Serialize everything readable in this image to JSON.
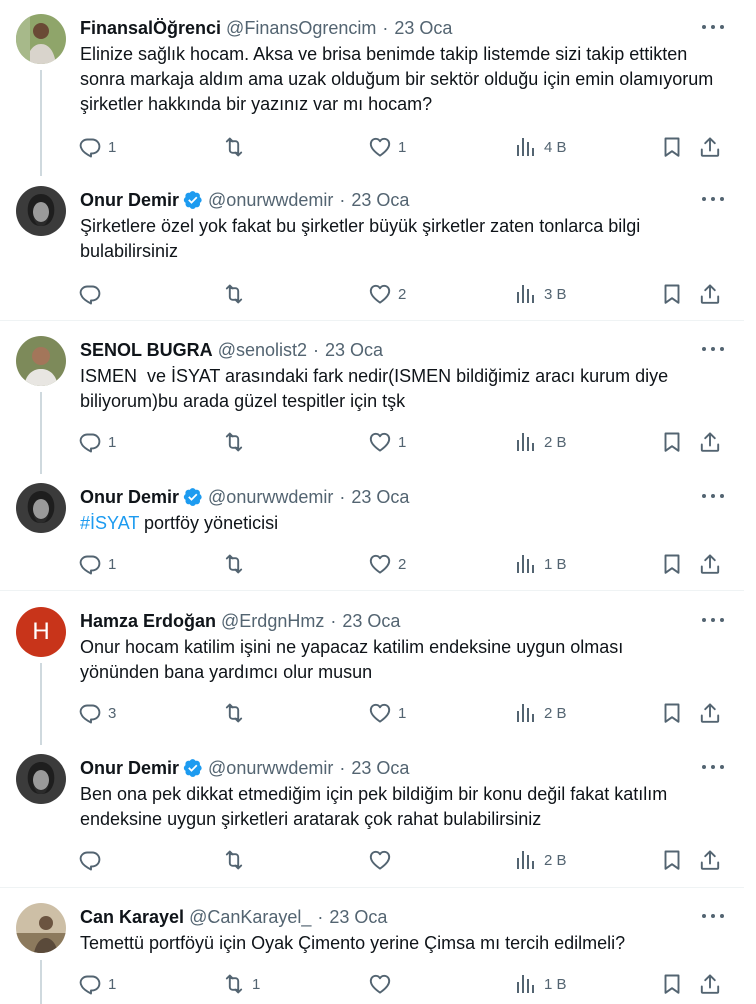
{
  "tweets": [
    {
      "name": "FinansalÖğrenci",
      "handle": "@FinansOgrencim",
      "dot": "·",
      "time": "23 Oca",
      "text": "Elinize sağlık hocam. Aksa ve brisa benimde takip listemde sizi takip ettikten sonra markaja aldım ama uzak olduğum bir sektör olduğu için emin olamıyorum şirketler hakkında bir yazınız var mı hocam?",
      "replies": "1",
      "retweets": "",
      "likes": "1",
      "views": "4 B",
      "avatar": "photo-finansal"
    },
    {
      "name": "Onur Demir",
      "handle": "@onurwwdemir",
      "dot": "·",
      "time": "23 Oca",
      "text": "Şirketlere özel yok fakat bu şirketler büyük şirketler zaten tonlarca bilgi bulabilirsiniz",
      "replies": "",
      "retweets": "",
      "likes": "2",
      "views": "3 B",
      "avatar": "photo-onur"
    },
    {
      "name": "SENOL BUGRA",
      "handle": "@senolist2",
      "dot": "·",
      "time": "23 Oca",
      "text": "ISMEN  ve İSYAT arasındaki fark nedir(ISMEN bildiğimiz aracı kurum diye biliyorum)bu arada güzel tespitler için tşk",
      "replies": "1",
      "retweets": "",
      "likes": "1",
      "views": "2 B",
      "avatar": "photo-senol"
    },
    {
      "name": "Onur Demir",
      "handle": "@onurwwdemir",
      "dot": "·",
      "time": "23 Oca",
      "hashtag": "#İSYAT",
      "text": " portföy yöneticisi",
      "replies": "1",
      "retweets": "",
      "likes": "2",
      "views": "1 B",
      "avatar": "photo-onur"
    },
    {
      "name": "Hamza Erdoğan",
      "handle": "@ErdgnHmz",
      "dot": "·",
      "time": "23 Oca",
      "text": "Onur hocam katilim işini ne yapacaz katilim endeksine uygun olması yönünden bana yardımcı olur musun",
      "replies": "3",
      "retweets": "",
      "likes": "1",
      "views": "2 B",
      "avatar_letter": "H"
    },
    {
      "name": "Onur Demir",
      "handle": "@onurwwdemir",
      "dot": "·",
      "time": "23 Oca",
      "text": "Ben ona pek dikkat etmediğim için pek bildiğim bir konu değil fakat katılım endeksine uygun şirketleri aratarak çok rahat bulabilirsiniz",
      "replies": "",
      "retweets": "",
      "likes": "",
      "views": "2 B",
      "avatar": "photo-onur"
    },
    {
      "name": "Can Karayel",
      "handle": "@CanKarayel_",
      "dot": "·",
      "time": "23 Oca",
      "text": "Temettü portföyü için Oyak Çimento yerine Çimsa mı tercih edilmeli?",
      "replies": "1",
      "retweets": "1",
      "likes": "",
      "views": "1 B",
      "avatar": "photo-can"
    }
  ],
  "colors": {
    "accent": "#1d9bf0",
    "muted": "#536471",
    "text": "#0f1419",
    "thread_line": "#cfd9de",
    "avatar_h": "#c8341a"
  },
  "icons": [
    "reply-icon",
    "retweet-icon",
    "like-icon",
    "views-icon",
    "bookmark-icon",
    "share-icon",
    "more-icon",
    "verified-badge-icon"
  ]
}
